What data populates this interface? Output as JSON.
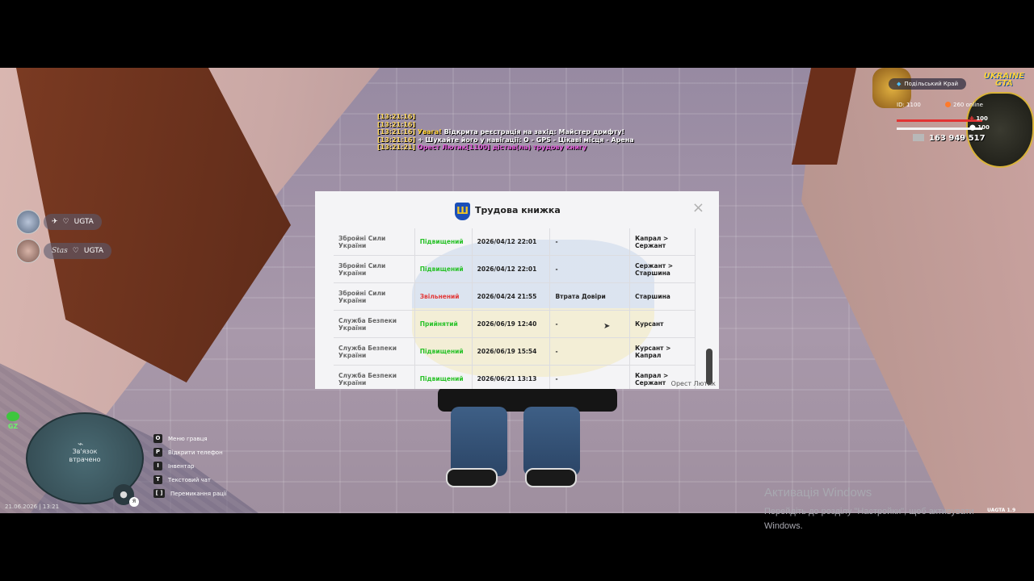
{
  "chat": [
    {
      "time": "[13:21:16]",
      "text": ""
    },
    {
      "time": "[13:21:16]",
      "text": ""
    },
    {
      "time": "[13:21:16]",
      "prefix": "Увага!",
      "text": "Відкрита реєстрація на захід: Майстер дрифту!"
    },
    {
      "time": "[13:21:16]",
      "prefix": "+",
      "text": "Шукайте його у навігації: O - GPS - Цікаві місця - Арена"
    },
    {
      "time": "[13:21:21]",
      "prefix": "",
      "text": "Орест Лютик[1100] дістав(ла) трудову книгу"
    }
  ],
  "players": [
    {
      "tag": "UGTA",
      "name": ""
    },
    {
      "tag": "UGTA",
      "name": "Stas"
    }
  ],
  "minimap": {
    "status": "Зв'язок\nвтрачено"
  },
  "gz_label": "GZ",
  "datetime": "21.06.2026 | 13:21",
  "mic_lang": "Я",
  "hints": [
    {
      "key": "O",
      "label": "Меню гравця"
    },
    {
      "key": "P",
      "label": "Відкрити телефон"
    },
    {
      "key": "I",
      "label": "Інвентар"
    },
    {
      "key": "T",
      "label": "Текстовий чат"
    },
    {
      "key": "[ ]",
      "label": "Перемикання рації"
    }
  ],
  "hud": {
    "server": "Подільський Край",
    "logo_line1": "UKRAINE",
    "logo_line2": "GTA",
    "id": "ID: 1100",
    "online": "260 online",
    "health": "100",
    "armor": "100",
    "money": "163 949 517"
  },
  "modal": {
    "title": "Трудова книжка",
    "close": "×",
    "signature": "Орест Лютик",
    "rows": [
      {
        "org": "Збройні Сили України",
        "status": "Підвищений",
        "status_type": "up",
        "date": "2026/04/12 22:01",
        "reason": "-",
        "rank": "Капрал > Сержант"
      },
      {
        "org": "Збройні Сили України",
        "status": "Підвищений",
        "status_type": "up",
        "date": "2026/04/12 22:01",
        "reason": "-",
        "rank": "Сержант > Старшина"
      },
      {
        "org": "Збройні Сили України",
        "status": "Звільнений",
        "status_type": "fire",
        "date": "2026/04/24 21:55",
        "reason": "Втрата Довіри",
        "rank": "Старшина"
      },
      {
        "org": "Служба Безпеки України",
        "status": "Прийнятий",
        "status_type": "hire",
        "date": "2026/06/19 12:40",
        "reason": "-",
        "rank": "Курсант"
      },
      {
        "org": "Служба Безпеки України",
        "status": "Підвищений",
        "status_type": "up",
        "date": "2026/06/19 15:54",
        "reason": "-",
        "rank": "Курсант > Капрал"
      },
      {
        "org": "Служба Безпеки України",
        "status": "Підвищений",
        "status_type": "up",
        "date": "2026/06/21 13:13",
        "reason": "-",
        "rank": "Капрал > Сержант"
      }
    ]
  },
  "windows_activation": {
    "title": "Активація Windows",
    "line1": "Перейдіть до розділу \"Настройки\", щоб активувати",
    "line2": "Windows."
  },
  "version": "UAGTA 1.9",
  "colors": {
    "accent_green": "#29c229",
    "accent_red": "#e23b3b",
    "chat_time": "#ffd966"
  }
}
